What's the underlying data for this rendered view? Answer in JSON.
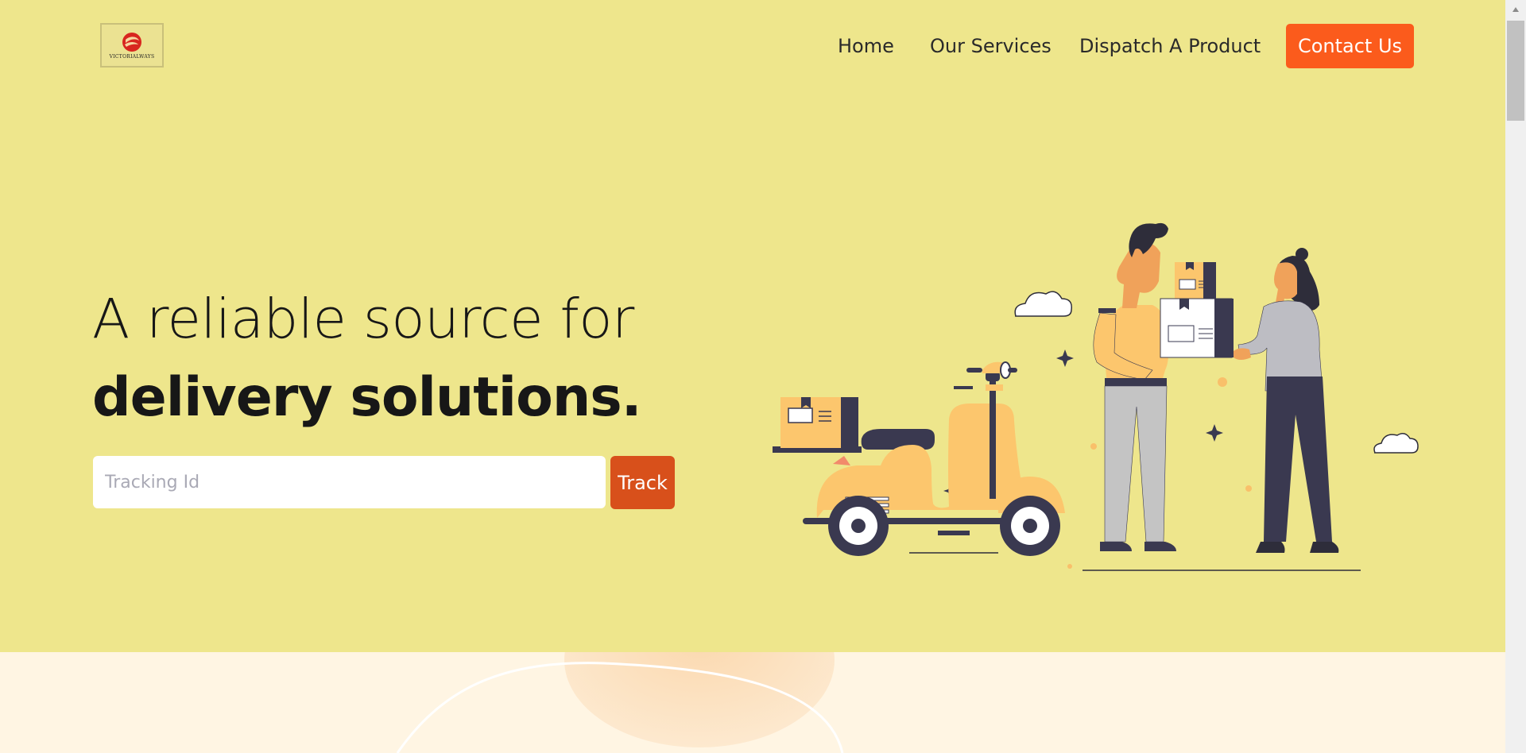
{
  "brand": {
    "logo_text": "VICTORIALWAYS"
  },
  "nav": {
    "home": "Home",
    "services": "Our Services",
    "dispatch": "Dispatch A Product",
    "contact": "Contact Us"
  },
  "hero": {
    "headline_line1": "A reliable source for",
    "headline_line2": "delivery solutions.",
    "tracking_placeholder": "Tracking Id",
    "track_button": "Track"
  },
  "colors": {
    "hero_bg": "#eee68c",
    "accent": "#fb5b1c",
    "track_button": "#d8501b",
    "section_bg": "#fff5e3"
  },
  "icons": [
    "logo-emblem-icon",
    "cloud-icon",
    "sparkle-icon",
    "scroll-up-arrow-icon"
  ]
}
